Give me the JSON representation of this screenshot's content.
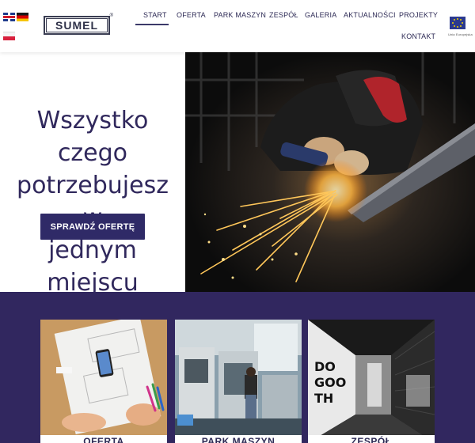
{
  "header": {
    "languages": [
      {
        "code": "en",
        "icon": "uk-flag-icon"
      },
      {
        "code": "de",
        "icon": "germany-flag-icon"
      },
      {
        "code": "pl",
        "icon": "poland-flag-icon"
      }
    ],
    "logo": {
      "text": "SUMEL",
      "mark": "®"
    },
    "nav": [
      {
        "label": "START",
        "active": true
      },
      {
        "label": "OFERTA",
        "active": false
      },
      {
        "label": "PARK MASZYN",
        "active": false
      },
      {
        "label": "ZESPÓŁ",
        "active": false
      },
      {
        "label": "GALERIA",
        "active": false
      },
      {
        "label": "AKTUALNOŚCI",
        "active": false
      },
      {
        "label": "PROJEKTY",
        "active": false
      },
      {
        "label": "KONTAKT",
        "active": false
      }
    ],
    "eu_badge": {
      "icon": "eu-flag-icon",
      "caption": "Unia Europejska"
    }
  },
  "hero": {
    "title_lines": [
      "Wszystko czego",
      "potrzebujesz w",
      "jednym miejscu"
    ],
    "cta_label": "SPRAWDŹ OFERTĘ",
    "image": "welder-grinding-sparks-photo"
  },
  "cards": [
    {
      "label": "OFERTA",
      "image": "desk-sketches-photo"
    },
    {
      "label": "PARK MASZYN",
      "image": "cnc-machines-photo"
    },
    {
      "label": "ZESPÓŁ",
      "image": "office-corridor-photo"
    }
  ],
  "colors": {
    "brand_purple": "#31275f",
    "button_purple": "#2f2a67",
    "title_text": "#30285c"
  }
}
